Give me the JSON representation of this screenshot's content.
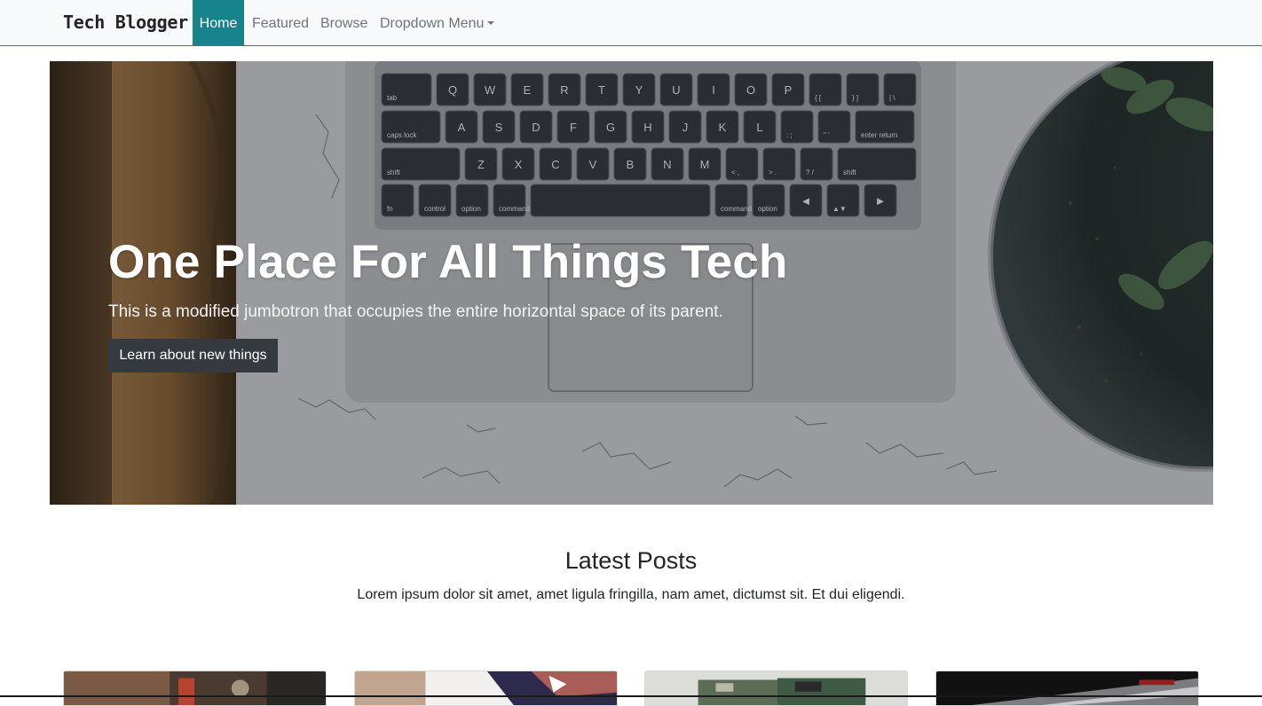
{
  "navbar": {
    "brand": "Tech Blogger",
    "items": [
      {
        "label": "Home",
        "active": true
      },
      {
        "label": "Featured"
      },
      {
        "label": "Browse"
      },
      {
        "label": "Dropdown Menu",
        "has_caret": true
      }
    ],
    "accent_color": "#17848c"
  },
  "hero": {
    "title": "One Place For All Things Tech",
    "subtitle": "This is a modified jumbotron that occupies the entire horizontal space of its parent.",
    "button_label": "Learn about new things"
  },
  "latest": {
    "title": "Latest Posts",
    "subtitle": "Lorem ipsum dolor sit amet, amet ligula fringilla, nam amet, dictumst sit. Et dui eligendi."
  },
  "cards": [
    {
      "image": "coffee-shop-image"
    },
    {
      "image": "laptop-screen-image"
    },
    {
      "image": "circuit-board-image"
    },
    {
      "image": "hardware-image"
    }
  ],
  "keyboard": {
    "rows": [
      [
        "tab",
        "Q",
        "W",
        "E",
        "R",
        "T",
        "Y",
        "U",
        "I",
        "O",
        "P",
        "{ [",
        "} ]",
        "| \\"
      ],
      [
        "caps lock",
        "A",
        "S",
        "D",
        "F",
        "G",
        "H",
        "J",
        "K",
        "L",
        ": ;",
        "\" '",
        "enter return"
      ],
      [
        "shift",
        "Z",
        "X",
        "C",
        "V",
        "B",
        "N",
        "M",
        "< ,",
        "> .",
        "? /",
        "shift"
      ],
      [
        "fn",
        "control",
        "option",
        "command",
        "",
        "command",
        "option",
        "◄",
        "▲▼",
        "►"
      ]
    ]
  }
}
